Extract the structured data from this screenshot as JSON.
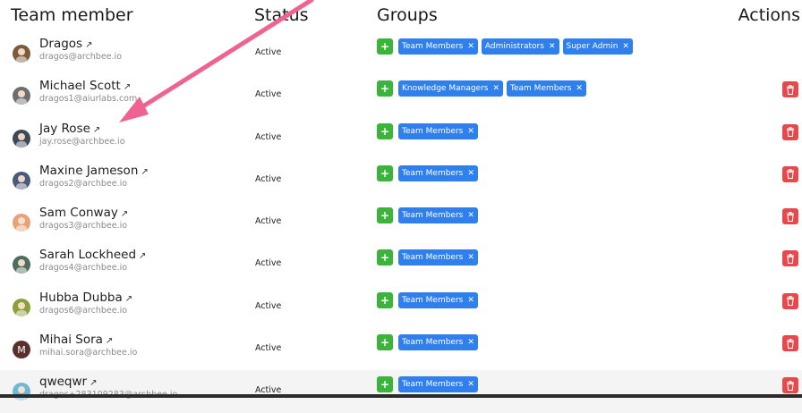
{
  "header": {
    "team_member": "Team member",
    "status": "Status",
    "groups": "Groups",
    "actions": "Actions"
  },
  "colors": {
    "add_button": "#3cb43c",
    "group_tag": "#2f80ed",
    "delete_button": "#e8474c",
    "annotation_arrow": "#f06292"
  },
  "members": [
    {
      "name": "Dragos",
      "email": "dragos@archbee.io",
      "status": "Active",
      "groups": [
        "Team Members",
        "Administrators",
        "Super Admin"
      ],
      "has_delete": false,
      "avatar": "photo"
    },
    {
      "name": "Michael Scott",
      "email": "dragos1@aiurlabs.com",
      "status": "Active",
      "groups": [
        "Knowledge Managers",
        "Team Members"
      ],
      "has_delete": true,
      "avatar": "photo"
    },
    {
      "name": "Jay Rose",
      "email": "jay.rose@archbee.io",
      "status": "Active",
      "groups": [
        "Team Members"
      ],
      "has_delete": true,
      "avatar": "photo"
    },
    {
      "name": "Maxine Jameson",
      "email": "dragos2@archbee.io",
      "status": "Active",
      "groups": [
        "Team Members"
      ],
      "has_delete": true,
      "avatar": "photo"
    },
    {
      "name": "Sam Conway",
      "email": "dragos3@archbee.io",
      "status": "Active",
      "groups": [
        "Team Members"
      ],
      "has_delete": true,
      "avatar": "photo"
    },
    {
      "name": "Sarah Lockheed",
      "email": "dragos4@archbee.io",
      "status": "Active",
      "groups": [
        "Team Members"
      ],
      "has_delete": true,
      "avatar": "photo"
    },
    {
      "name": "Hubba Dubba",
      "email": "dragos6@archbee.io",
      "status": "Active",
      "groups": [
        "Team Members"
      ],
      "has_delete": true,
      "avatar": "photo"
    },
    {
      "name": "Mihai Sora",
      "email": "mihai.sora@archbee.io",
      "status": "Active",
      "groups": [
        "Team Members"
      ],
      "has_delete": true,
      "avatar": "M"
    },
    {
      "name": "qweqwr",
      "email": "dragos+283109283@archbee.io",
      "status": "Active",
      "groups": [
        "Team Members"
      ],
      "has_delete": true,
      "avatar": "photo"
    }
  ]
}
